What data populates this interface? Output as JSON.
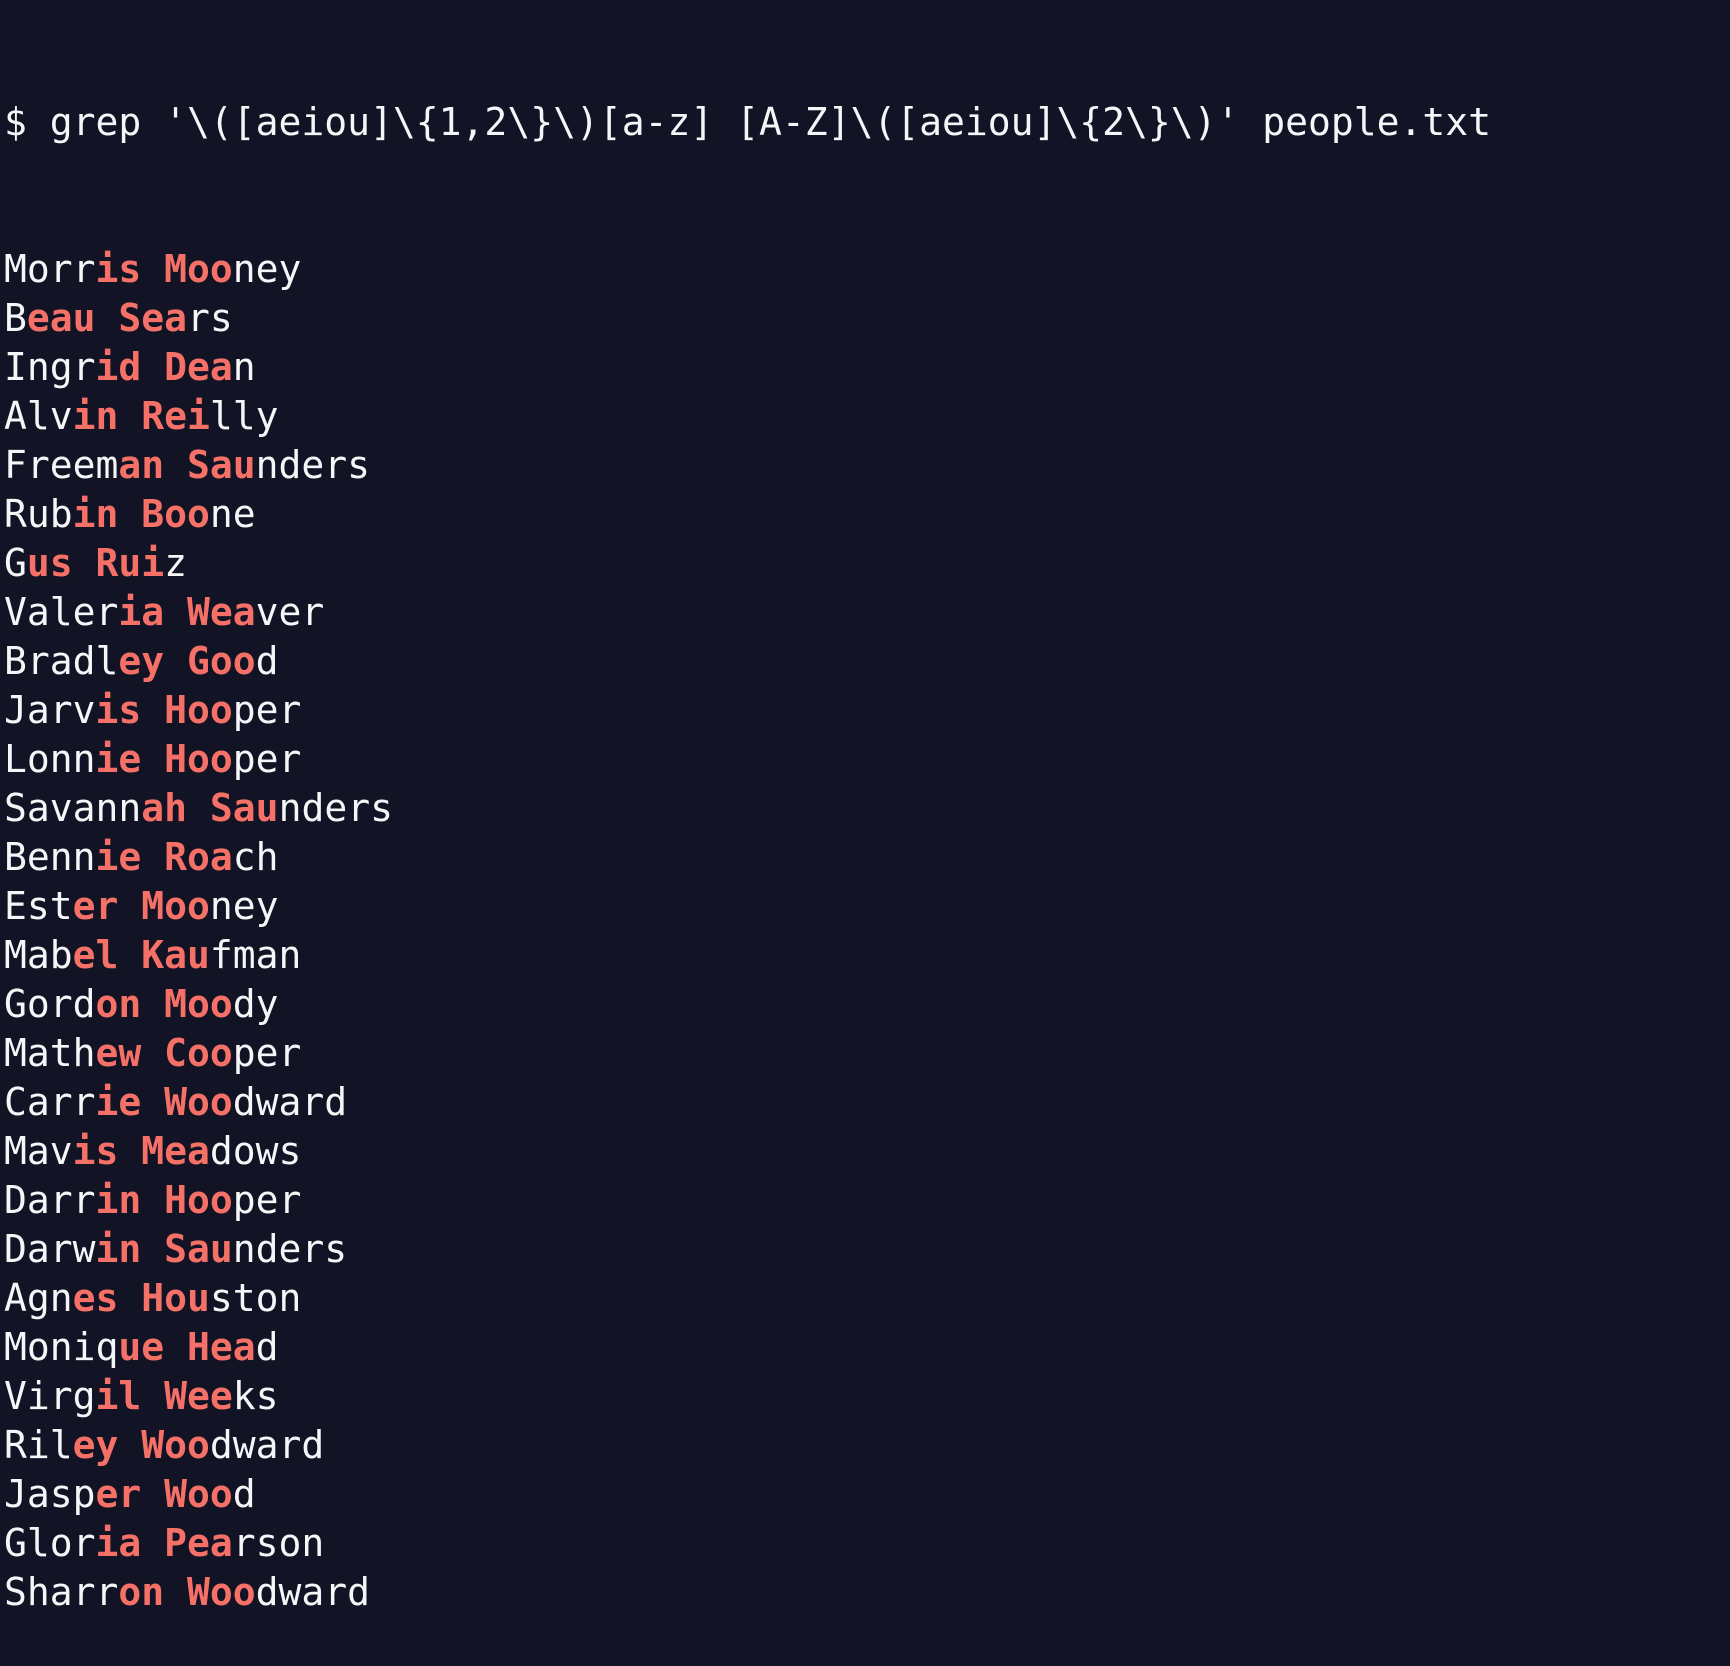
{
  "terminal": {
    "command_line": "$ grep '\\([aeiou]\\{1,2\\}\\)[a-z] [A-Z]\\([aeiou]\\{2\\}\\)' people.txt",
    "highlight_color": "#f57167",
    "text_color": "#f5f6f8",
    "background_color": "#131326",
    "results": [
      {
        "name": "Morris Mooney",
        "segments": [
          {
            "text": "Morr",
            "hl": false
          },
          {
            "text": "is Moo",
            "hl": true
          },
          {
            "text": "ney",
            "hl": false
          }
        ]
      },
      {
        "name": "Beau Sears",
        "segments": [
          {
            "text": "B",
            "hl": false
          },
          {
            "text": "eau Sea",
            "hl": true
          },
          {
            "text": "rs",
            "hl": false
          }
        ]
      },
      {
        "name": "Ingrid Dean",
        "segments": [
          {
            "text": "Ingr",
            "hl": false
          },
          {
            "text": "id Dea",
            "hl": true
          },
          {
            "text": "n",
            "hl": false
          }
        ]
      },
      {
        "name": "Alvin Reilly",
        "segments": [
          {
            "text": "Alv",
            "hl": false
          },
          {
            "text": "in Rei",
            "hl": true
          },
          {
            "text": "lly",
            "hl": false
          }
        ]
      },
      {
        "name": "Freeman Saunders",
        "segments": [
          {
            "text": "Freem",
            "hl": false
          },
          {
            "text": "an Sau",
            "hl": true
          },
          {
            "text": "nders",
            "hl": false
          }
        ]
      },
      {
        "name": "Rubin Boone",
        "segments": [
          {
            "text": "Rub",
            "hl": false
          },
          {
            "text": "in Boo",
            "hl": true
          },
          {
            "text": "ne",
            "hl": false
          }
        ]
      },
      {
        "name": "Gus Ruiz",
        "segments": [
          {
            "text": "G",
            "hl": false
          },
          {
            "text": "us Rui",
            "hl": true
          },
          {
            "text": "z",
            "hl": false
          }
        ]
      },
      {
        "name": "Valeria Weaver",
        "segments": [
          {
            "text": "Valer",
            "hl": false
          },
          {
            "text": "ia Wea",
            "hl": true
          },
          {
            "text": "ver",
            "hl": false
          }
        ]
      },
      {
        "name": "Bradley Good",
        "segments": [
          {
            "text": "Bradl",
            "hl": false
          },
          {
            "text": "ey Goo",
            "hl": true
          },
          {
            "text": "d",
            "hl": false
          }
        ]
      },
      {
        "name": "Jarvis Hooper",
        "segments": [
          {
            "text": "Jarv",
            "hl": false
          },
          {
            "text": "is Hoo",
            "hl": true
          },
          {
            "text": "per",
            "hl": false
          }
        ]
      },
      {
        "name": "Lonnie Hooper",
        "segments": [
          {
            "text": "Lonn",
            "hl": false
          },
          {
            "text": "ie Hoo",
            "hl": true
          },
          {
            "text": "per",
            "hl": false
          }
        ]
      },
      {
        "name": "Savannah Saunders",
        "segments": [
          {
            "text": "Savann",
            "hl": false
          },
          {
            "text": "ah Sau",
            "hl": true
          },
          {
            "text": "nders",
            "hl": false
          }
        ]
      },
      {
        "name": "Bennie Roach",
        "segments": [
          {
            "text": "Benn",
            "hl": false
          },
          {
            "text": "ie Roa",
            "hl": true
          },
          {
            "text": "ch",
            "hl": false
          }
        ]
      },
      {
        "name": "Ester Mooney",
        "segments": [
          {
            "text": "Est",
            "hl": false
          },
          {
            "text": "er Moo",
            "hl": true
          },
          {
            "text": "ney",
            "hl": false
          }
        ]
      },
      {
        "name": "Mabel Kaufman",
        "segments": [
          {
            "text": "Mab",
            "hl": false
          },
          {
            "text": "el Kau",
            "hl": true
          },
          {
            "text": "fman",
            "hl": false
          }
        ]
      },
      {
        "name": "Gordon Moody",
        "segments": [
          {
            "text": "Gord",
            "hl": false
          },
          {
            "text": "on Moo",
            "hl": true
          },
          {
            "text": "dy",
            "hl": false
          }
        ]
      },
      {
        "name": "Mathew Cooper",
        "segments": [
          {
            "text": "Math",
            "hl": false
          },
          {
            "text": "ew Coo",
            "hl": true
          },
          {
            "text": "per",
            "hl": false
          }
        ]
      },
      {
        "name": "Carrie Woodward",
        "segments": [
          {
            "text": "Carr",
            "hl": false
          },
          {
            "text": "ie Woo",
            "hl": true
          },
          {
            "text": "dward",
            "hl": false
          }
        ]
      },
      {
        "name": "Mavis Meadows",
        "segments": [
          {
            "text": "Mav",
            "hl": false
          },
          {
            "text": "is Mea",
            "hl": true
          },
          {
            "text": "dows",
            "hl": false
          }
        ]
      },
      {
        "name": "Darrin Hooper",
        "segments": [
          {
            "text": "Darr",
            "hl": false
          },
          {
            "text": "in Hoo",
            "hl": true
          },
          {
            "text": "per",
            "hl": false
          }
        ]
      },
      {
        "name": "Darwin Saunders",
        "segments": [
          {
            "text": "Darw",
            "hl": false
          },
          {
            "text": "in Sau",
            "hl": true
          },
          {
            "text": "nders",
            "hl": false
          }
        ]
      },
      {
        "name": "Agnes Houston",
        "segments": [
          {
            "text": "Agn",
            "hl": false
          },
          {
            "text": "es Hou",
            "hl": true
          },
          {
            "text": "ston",
            "hl": false
          }
        ]
      },
      {
        "name": "Monique Head",
        "segments": [
          {
            "text": "Moniq",
            "hl": false
          },
          {
            "text": "ue Hea",
            "hl": true
          },
          {
            "text": "d",
            "hl": false
          }
        ]
      },
      {
        "name": "Virgil Weeks",
        "segments": [
          {
            "text": "Virg",
            "hl": false
          },
          {
            "text": "il Wee",
            "hl": true
          },
          {
            "text": "ks",
            "hl": false
          }
        ]
      },
      {
        "name": "Riley Woodward",
        "segments": [
          {
            "text": "Ril",
            "hl": false
          },
          {
            "text": "ey Woo",
            "hl": true
          },
          {
            "text": "dward",
            "hl": false
          }
        ]
      },
      {
        "name": "Jasper Wood",
        "segments": [
          {
            "text": "Jasp",
            "hl": false
          },
          {
            "text": "er Woo",
            "hl": true
          },
          {
            "text": "d",
            "hl": false
          }
        ]
      },
      {
        "name": "Gloria Pearson",
        "segments": [
          {
            "text": "Glor",
            "hl": false
          },
          {
            "text": "ia Pea",
            "hl": true
          },
          {
            "text": "rson",
            "hl": false
          }
        ]
      },
      {
        "name": "Sharron Woodward",
        "segments": [
          {
            "text": "Sharr",
            "hl": false
          },
          {
            "text": "on Woo",
            "hl": true
          },
          {
            "text": "dward",
            "hl": false
          }
        ]
      }
    ]
  }
}
